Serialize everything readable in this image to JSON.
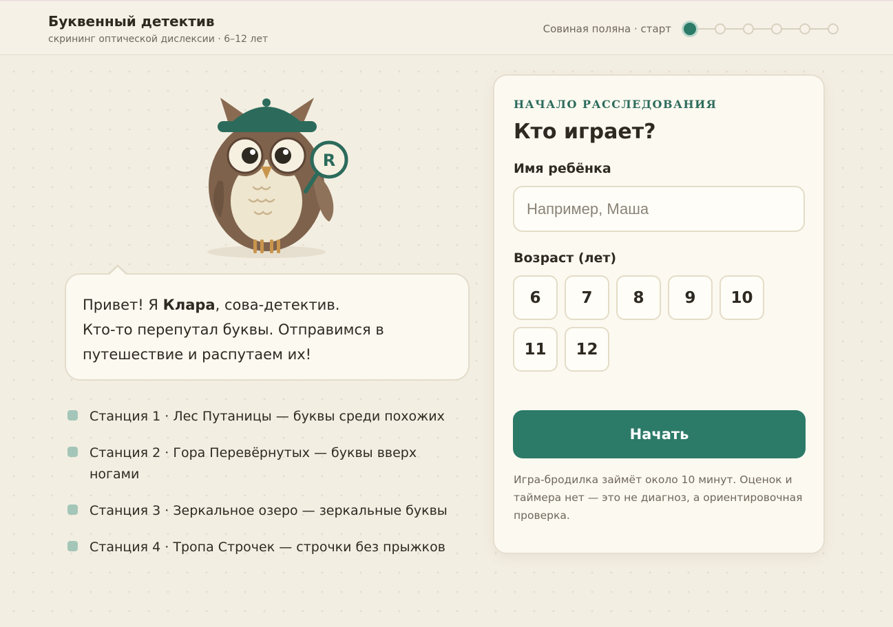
{
  "header": {
    "title": "Буквенный детектив",
    "subtitle": "скрининг оптической дислексии · 6–12 лет",
    "progress_label": "Совиная поляна · старт",
    "progress_current": 1,
    "progress_total": 6
  },
  "owl": {
    "magnifier_letter": "R"
  },
  "speech": {
    "greeting_prefix": "Привет! Я ",
    "name": "Клара",
    "greeting_suffix": ", сова-детектив.",
    "line2": "Кто-то перепутал буквы. Отправимся в путешествие и распутаем их!"
  },
  "stations": [
    "Станция 1 · Лес Путаницы — буквы среди похожих",
    "Станция 2 · Гора Перевёрнутых — буквы вверх ногами",
    "Станция 3 · Зеркальное озеро — зеркальные буквы",
    "Станция 4 · Тропа Строчек — строчки без прыжков"
  ],
  "form": {
    "kicker": "НАЧАЛО РАССЛЕДОВАНИЯ",
    "title": "Кто играет?",
    "name_label": "Имя ребёнка",
    "name_placeholder": "Например, Маша",
    "name_value": "",
    "age_label": "Возраст (лет)",
    "ages": [
      "6",
      "7",
      "8",
      "9",
      "10",
      "11",
      "12"
    ],
    "start_label": "Начать",
    "note": "Игра-бродилка займёт около 10 минут. Оценок и таймера нет — это не диагноз, а ориентировочная проверка."
  },
  "colors": {
    "accent": "#2c7a68",
    "background": "#f3eee2",
    "card": "#fcf9f1",
    "bullet": "#a3c6b8"
  }
}
